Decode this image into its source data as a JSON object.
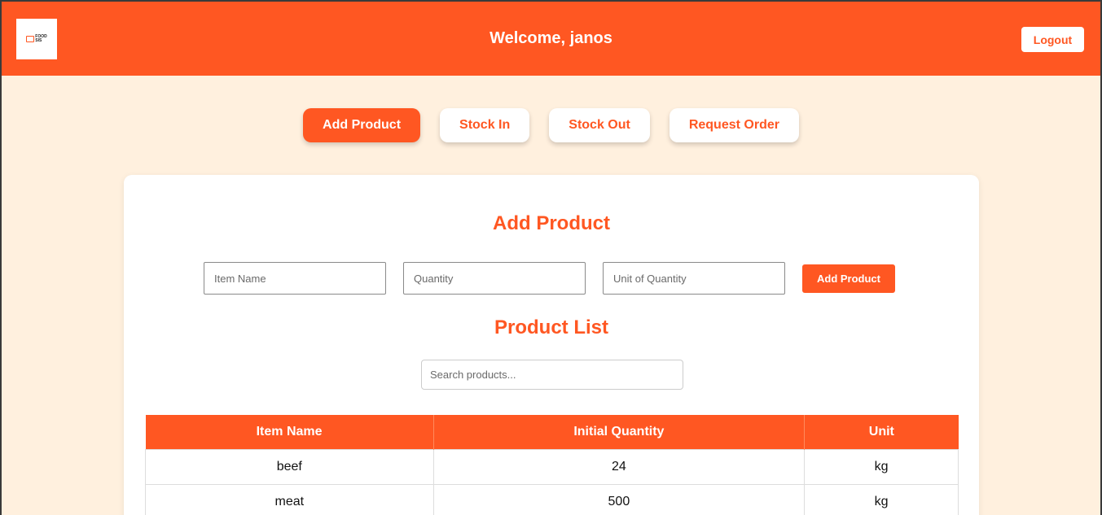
{
  "header": {
    "logo_text_top": "FOOD",
    "logo_text_bottom": "SIS",
    "welcome": "Welcome, janos",
    "logout_label": "Logout"
  },
  "nav": {
    "items": [
      {
        "label": "Add Product",
        "active": true
      },
      {
        "label": "Stock In",
        "active": false
      },
      {
        "label": "Stock Out",
        "active": false
      },
      {
        "label": "Request Order",
        "active": false
      }
    ]
  },
  "add_product": {
    "title": "Add Product",
    "item_name_placeholder": "Item Name",
    "quantity_placeholder": "Quantity",
    "unit_placeholder": "Unit of Quantity",
    "item_name_value": "",
    "quantity_value": "",
    "unit_value": "",
    "submit_label": "Add Product"
  },
  "product_list": {
    "title": "Product List",
    "search_placeholder": "Search products...",
    "columns": [
      "Item Name",
      "Initial Quantity",
      "Unit"
    ],
    "rows": [
      [
        "beef",
        "24",
        "kg"
      ],
      [
        "meat",
        "500",
        "kg"
      ]
    ]
  },
  "colors": {
    "accent": "#ff5722",
    "background": "#fff0de"
  }
}
